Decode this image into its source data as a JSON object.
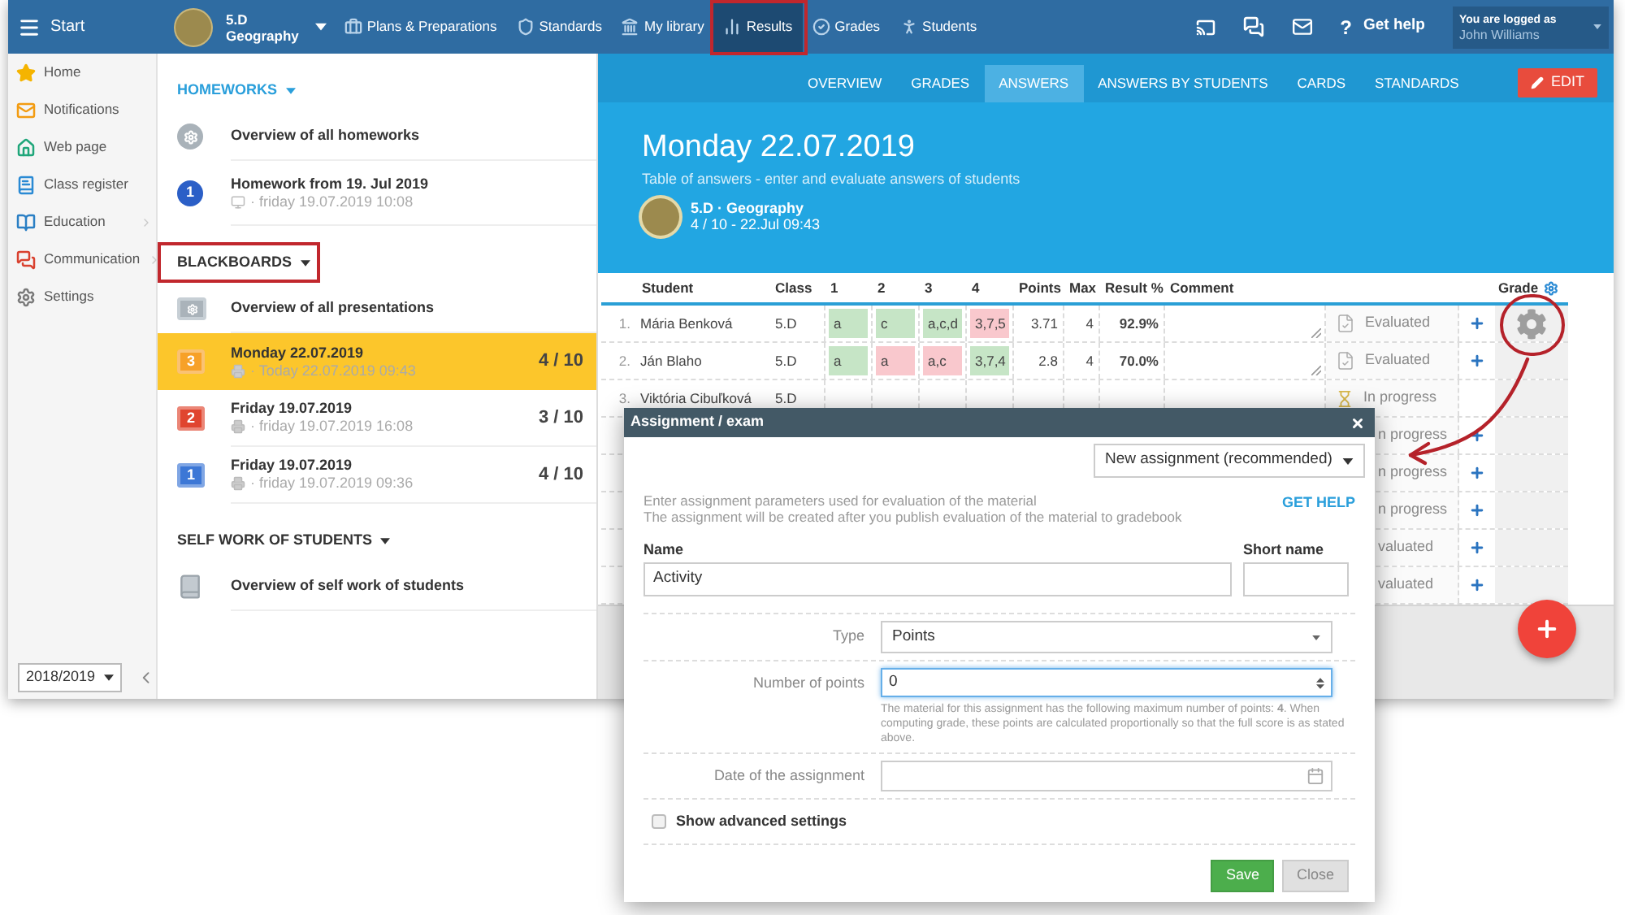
{
  "topbar": {
    "menu_label": "Start",
    "class": {
      "name": "5.D",
      "subject": "Geography"
    },
    "nav": [
      {
        "label": "Plans & Preparations",
        "selected": false
      },
      {
        "label": "Standards",
        "selected": false
      },
      {
        "label": "My library",
        "selected": false
      },
      {
        "label": "Results",
        "selected": true
      },
      {
        "label": "Grades",
        "selected": false
      },
      {
        "label": "Students",
        "selected": false
      }
    ],
    "help": {
      "mark": "?",
      "label": "Get help"
    },
    "user": {
      "caption": "You are logged as",
      "name": "John Williams"
    }
  },
  "sidebar": {
    "items": [
      {
        "label": "Home",
        "submenu": false
      },
      {
        "label": "Notifications",
        "submenu": false
      },
      {
        "label": "Web page",
        "submenu": false
      },
      {
        "label": "Class register",
        "submenu": false
      },
      {
        "label": "Education",
        "submenu": true
      },
      {
        "label": "Communication",
        "submenu": true
      },
      {
        "label": "Settings",
        "submenu": false
      }
    ],
    "school_year": "2018/2019"
  },
  "materials": {
    "sections": [
      {
        "title": "HOMEWORKS",
        "active": true,
        "items": [
          {
            "kind": "overview",
            "title": "Overview of all homeworks",
            "selected": false
          },
          {
            "kind": "homework",
            "badge": "1",
            "color": "#2b5fc7",
            "title": "Homework from 19. Jul 2019",
            "subtitle": "· friday 19.07.2019 10:08",
            "selected": false
          }
        ]
      },
      {
        "title": "BLACKBOARDS",
        "active": false,
        "items": [
          {
            "kind": "overview",
            "title": "Overview of all presentations",
            "selected": false
          },
          {
            "kind": "blackboard",
            "badge": "3",
            "color": "#f7a128",
            "title": "Monday 22.07.2019",
            "subtitle": "· Today 22.07.2019 09:43",
            "score": "4 / 10",
            "selected": true
          },
          {
            "kind": "blackboard",
            "badge": "2",
            "color": "#e0452f",
            "title": "Friday 19.07.2019",
            "subtitle": "· friday 19.07.2019 16:08",
            "score": "3 / 10",
            "selected": false
          },
          {
            "kind": "blackboard",
            "badge": "1",
            "color": "#3c77d6",
            "title": "Friday 19.07.2019",
            "subtitle": "· friday 19.07.2019 09:36",
            "score": "4 / 10",
            "selected": false
          }
        ]
      },
      {
        "title": "SELF WORK OF STUDENTS",
        "active": false,
        "items": [
          {
            "kind": "overview",
            "title": "Overview of self work of students",
            "selected": false
          }
        ]
      }
    ]
  },
  "tabs": [
    {
      "label": "OVERVIEW",
      "selected": false
    },
    {
      "label": "GRADES",
      "selected": false
    },
    {
      "label": "ANSWERS",
      "selected": true
    },
    {
      "label": "ANSWERS BY STUDENTS",
      "selected": false
    },
    {
      "label": "CARDS",
      "selected": false
    },
    {
      "label": "STANDARDS",
      "selected": false
    }
  ],
  "edit_button": "EDIT",
  "header": {
    "title": "Monday 22.07.2019",
    "subtitle": "Table of answers - enter and evaluate answers of students",
    "class_line": "5.D · Geography",
    "meta": "4 / 10 - 22.Jul 09:43"
  },
  "table": {
    "columns": [
      "Student",
      "Class",
      "1",
      "2",
      "3",
      "4",
      "Points",
      "Max",
      "Result %",
      "Comment",
      "Grade"
    ],
    "rows": [
      {
        "kind": "full",
        "number": "1.",
        "student": "Mária Benková",
        "class": "5.D",
        "answers": [
          {
            "text": "a",
            "correct": true
          },
          {
            "text": "c",
            "correct": true
          },
          {
            "text": "a,c,d",
            "correct": true
          },
          {
            "text": "3,7,5",
            "correct": false
          }
        ],
        "points": "3.71",
        "max": "4",
        "result": "92.9%",
        "evaluated": true,
        "status": "Evaluated",
        "add_button": true,
        "grade_settings": true
      },
      {
        "kind": "full",
        "number": "2.",
        "student": "Ján Blaho",
        "class": "5.D",
        "answers": [
          {
            "text": "a",
            "correct": true
          },
          {
            "text": "a",
            "correct": false
          },
          {
            "text": "a,c",
            "correct": false
          },
          {
            "text": "3,7,4",
            "correct": true
          }
        ],
        "points": "2.8",
        "max": "4",
        "result": "70.0%",
        "evaluated": true,
        "status": "Evaluated",
        "add_button": true,
        "grade_settings": false
      },
      {
        "kind": "top",
        "number": "3.",
        "student": "Viktória Cibuľková",
        "class": "5.D",
        "evaluated": false,
        "status": "In progress",
        "add_button": false,
        "grade_settings": false
      },
      {
        "kind": "covered",
        "status": "n progress",
        "add_button": true,
        "grade_settings": false
      },
      {
        "kind": "covered",
        "status": "n progress",
        "add_button": true,
        "grade_settings": false
      },
      {
        "kind": "covered",
        "status": "n progress",
        "add_button": true,
        "grade_settings": false
      },
      {
        "kind": "covered",
        "status": "valuated",
        "add_button": true,
        "grade_settings": false
      },
      {
        "kind": "covered",
        "status": "valuated",
        "add_button": true,
        "grade_settings": false
      }
    ]
  },
  "dialog": {
    "title": "Assignment / exam",
    "mode": "New assignment (recommended)",
    "intro": [
      "Enter assignment parameters used for evaluation of the material",
      "The assignment will be created after you publish evaluation of the material to gradebook"
    ],
    "help_link": "GET HELP",
    "name": {
      "label": "Name",
      "value": "Activity"
    },
    "short_name": {
      "label": "Short name"
    },
    "fields": [
      {
        "kind": "select",
        "label": "Type",
        "value": "Points"
      },
      {
        "kind": "number",
        "label": "Number of points",
        "value": "0",
        "focused": true,
        "hint": "The material for this assignment has the following maximum number of points: **4**. When computing grade, these points are calculated proportionally so that the full score is as stated above."
      },
      {
        "kind": "date",
        "label": "Date of the assignment"
      }
    ],
    "advanced": {
      "label": "Show advanced settings",
      "checked": false
    },
    "buttons": [
      {
        "label": "Save",
        "kind": "primary"
      },
      {
        "label": "Close",
        "kind": "secondary"
      }
    ]
  }
}
